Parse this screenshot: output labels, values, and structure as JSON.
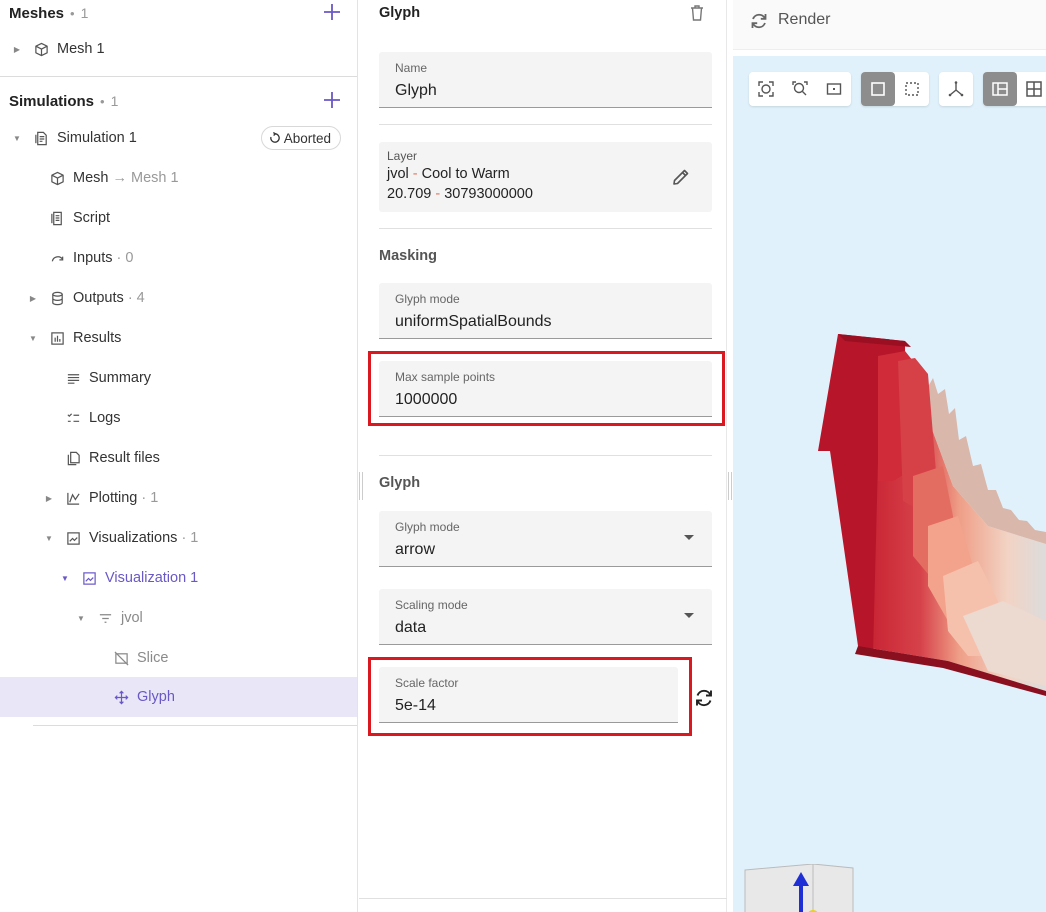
{
  "tree": {
    "meshes": {
      "title": "Meshes",
      "count": "1",
      "items": [
        {
          "label": "Mesh 1"
        }
      ]
    },
    "simulations": {
      "title": "Simulations",
      "count": "1",
      "simulation": {
        "label": "Simulation 1",
        "status": "Aborted"
      },
      "mesh_link": {
        "label": "Mesh",
        "target": "Mesh 1"
      },
      "script": {
        "label": "Script"
      },
      "inputs": {
        "label": "Inputs",
        "count": "0"
      },
      "outputs": {
        "label": "Outputs",
        "count": "4"
      },
      "results": {
        "label": "Results"
      },
      "summary": {
        "label": "Summary"
      },
      "logs": {
        "label": "Logs"
      },
      "result_files": {
        "label": "Result files"
      },
      "plotting": {
        "label": "Plotting",
        "count": "1"
      },
      "visualizations": {
        "label": "Visualizations",
        "count": "1"
      },
      "visualization1": {
        "label": "Visualization 1"
      },
      "jvol": {
        "label": "jvol"
      },
      "slice": {
        "label": "Slice"
      },
      "glyph": {
        "label": "Glyph"
      }
    }
  },
  "config": {
    "title": "Glyph",
    "name": {
      "label": "Name",
      "value": "Glyph"
    },
    "layer": {
      "label": "Layer",
      "field": "jvol",
      "colormap": "Cool to Warm",
      "range_min": "20.709",
      "range_max": "30793000000"
    },
    "masking": {
      "title": "Masking",
      "glyph_mode": {
        "label": "Glyph mode",
        "value": "uniformSpatialBounds"
      },
      "max_sample_points": {
        "label": "Max sample points",
        "value": "1000000"
      }
    },
    "glyph": {
      "title": "Glyph",
      "glyph_mode": {
        "label": "Glyph mode",
        "value": "arrow"
      },
      "scaling_mode": {
        "label": "Scaling mode",
        "value": "data"
      },
      "scale_factor": {
        "label": "Scale factor",
        "value": "5e-14"
      }
    }
  },
  "viewport": {
    "render_label": "Render",
    "background_color": "#e1f1fb"
  },
  "colors": {
    "accent": "#6a58c7",
    "highlight": "#d9191f",
    "selected_row": "#e9e6f7"
  }
}
